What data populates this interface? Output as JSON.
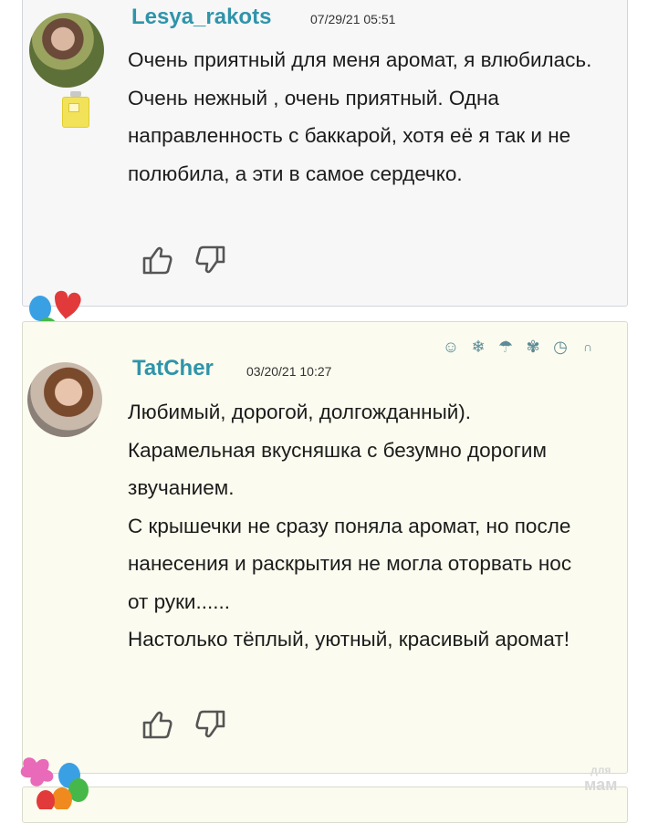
{
  "comments": [
    {
      "username": "Lesya_rakots",
      "date": "07/29/21 05:51",
      "avatar_icon": "user-avatar-photo",
      "badge_icon": "perfume-bottle-icon",
      "paragraphs": [
        "Очень приятный для меня аромат, я влюбилась. Очень нежный , очень приятный. Одна направленность с баккарой, хотя её я так и не полюбила, а эти в самое сердечко."
      ]
    },
    {
      "username": "TatCher",
      "date": "03/20/21 10:27",
      "avatar_icon": "user-avatar-photo",
      "paragraphs": [
        "Любимый, дорогой, долгожданный).",
        "Карамельная вкусняшка с безумно дорогим звучанием.",
        "С крышечки не сразу поняла аромат, но после нанесения и раскрытия не могла оторвать нос от руки......",
        "Настолько тёплый, уютный, красивый аромат!"
      ]
    }
  ],
  "status_icons": [
    "smiley-icon",
    "snowflake-icon",
    "umbrella-icon",
    "maple-leaf-icon",
    "clock-icon",
    "horseshoe-icon"
  ],
  "watermark": {
    "top": "для",
    "bottom": "мам"
  },
  "colors": {
    "username": "#2f94aa",
    "card1_bg": "#f7f7f8",
    "card2_bg": "#fbfbef"
  }
}
